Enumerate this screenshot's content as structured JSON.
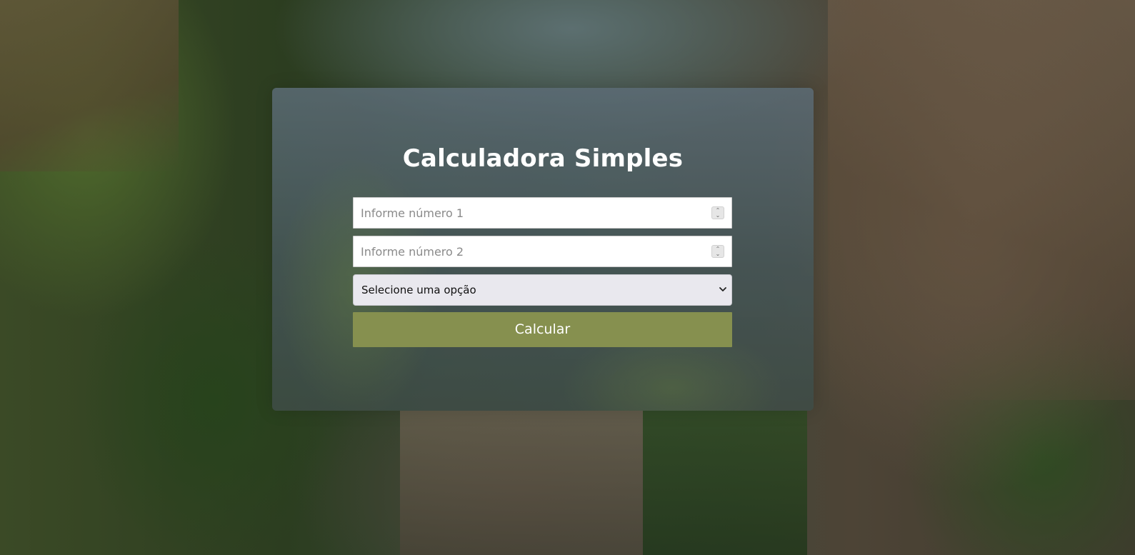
{
  "page": {
    "title": "Calculadora Simples"
  },
  "form": {
    "number1": {
      "placeholder": "Informe número 1",
      "value": ""
    },
    "number2": {
      "placeholder": "Informe número 2",
      "value": ""
    },
    "operation": {
      "selected_label": "Selecione uma opção"
    },
    "submit_label": "Calcular"
  },
  "colors": {
    "button_bg": "#86904f",
    "title_text": "#ffffff",
    "card_bg": "#5c6c76"
  },
  "icons": {
    "spinner": "spinner-arrows-icon",
    "select": "chevron-down-icon"
  }
}
